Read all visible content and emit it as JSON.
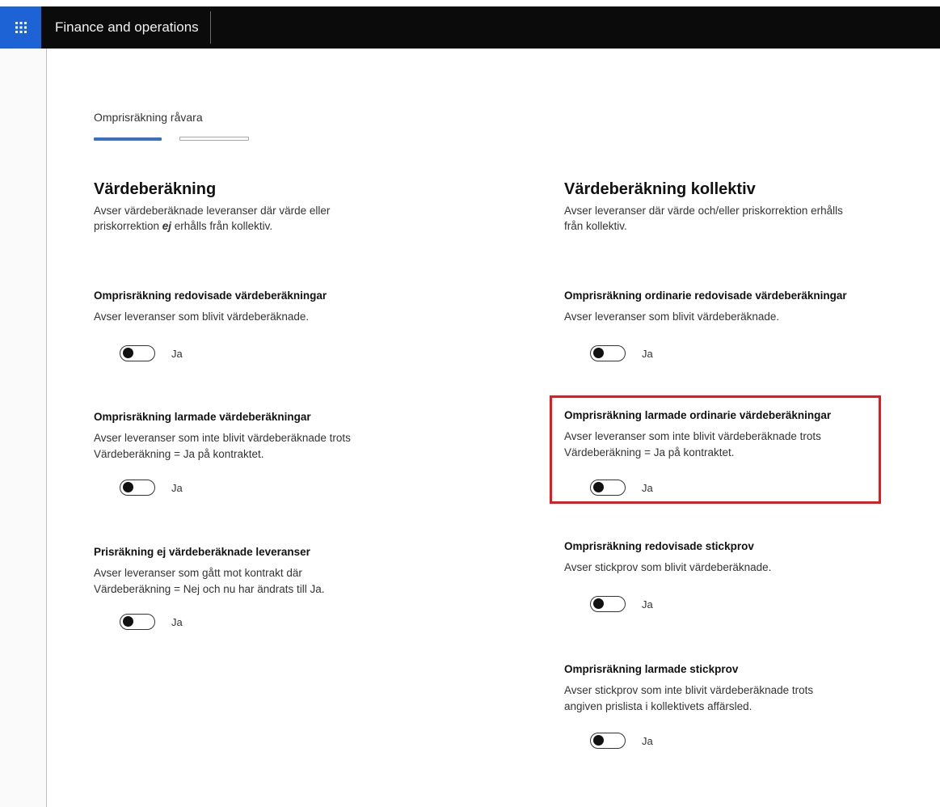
{
  "app": {
    "waffle_icon": "waffle-grid-icon",
    "title": "Finance and operations"
  },
  "tab": {
    "label": "Omprisräkning råvara",
    "progress": {
      "active_step": 1,
      "total_steps": 2
    }
  },
  "left_section": {
    "title": "Värdeberäkning",
    "desc_part1": "Avser värdeberäknade leveranser där värde eller priskorrektion ",
    "desc_emph": "ej",
    "desc_part2": " erhålls från kollektiv.",
    "items": [
      {
        "title": "Omprisräkning redovisade värdeberäkningar",
        "desc": "Avser leveranser som blivit värdeberäknade.",
        "toggle_label": "Ja",
        "toggle_on": false
      },
      {
        "title": "Omprisräkning larmade värdeberäkningar",
        "desc": "Avser leveranser som inte blivit värdeberäknade trots Värdeberäkning = Ja på kontraktet.",
        "toggle_label": "Ja",
        "toggle_on": false
      },
      {
        "title": "Prisräkning ej värdeberäknade leveranser",
        "desc": "Avser leveranser som gått mot kontrakt där Värdeberäkning = Nej och nu har ändrats till Ja.",
        "toggle_label": "Ja",
        "toggle_on": false
      }
    ]
  },
  "right_section": {
    "title": "Värdeberäkning kollektiv",
    "desc": "Avser leveranser där värde och/eller priskorrektion erhålls från kollektiv.",
    "items": [
      {
        "title": "Omprisräkning ordinarie redovisade värdeberäkningar",
        "desc": "Avser leveranser som blivit värdeberäknade.",
        "toggle_label": "Ja",
        "toggle_on": false
      },
      {
        "title": "Omprisräkning larmade ordinarie värdeberäkningar",
        "desc": "Avser leveranser som inte blivit värdeberäknade trots Värdeberäkning = Ja på kontraktet.",
        "toggle_label": "Ja",
        "toggle_on": false,
        "highlighted": true
      },
      {
        "title": "Omprisräkning redovisade stickprov",
        "desc": "Avser stickprov som blivit värdeberäknade.",
        "toggle_label": "Ja",
        "toggle_on": false
      },
      {
        "title": "Omprisräkning larmade stickprov",
        "desc": "Avser stickprov som inte blivit värdeberäknade trots angiven prislista i kollektivets affärsled.",
        "toggle_label": "Ja",
        "toggle_on": false
      }
    ]
  },
  "colors": {
    "topbar": "#0b0b0b",
    "waffle_bg": "#1e63d6",
    "progress_active": "#3a6fc4",
    "highlight": "#e8181f"
  }
}
